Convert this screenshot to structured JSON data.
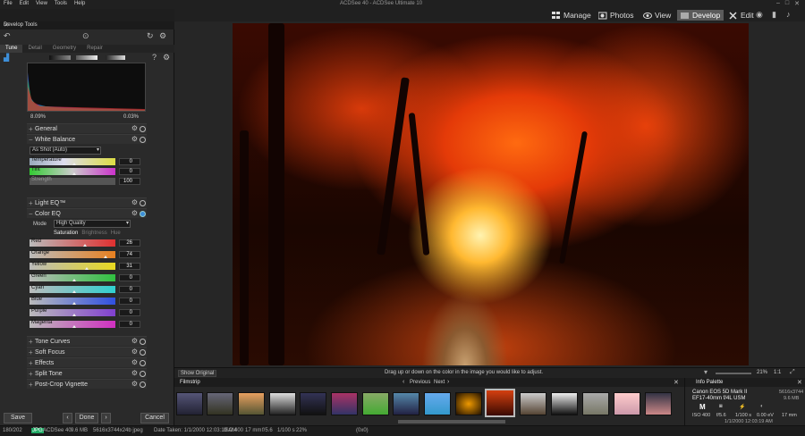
{
  "menu": [
    "File",
    "Edit",
    "View",
    "Tools",
    "Help"
  ],
  "app_title": "ACDSee 40 - ACDSee Ultimate 10",
  "modes": [
    {
      "label": "Manage",
      "icon": "grid-icon"
    },
    {
      "label": "Photos",
      "icon": "photos-icon"
    },
    {
      "label": "View",
      "icon": "eye-icon"
    },
    {
      "label": "Develop",
      "icon": "develop-icon"
    },
    {
      "label": "Edit",
      "icon": "edit-icon"
    }
  ],
  "develop_tools": {
    "title": "Develop Tools",
    "tabs": [
      "Tune",
      "Detail",
      "Geometry",
      "Repair"
    ],
    "histogram": {
      "left_pct": "8.09%",
      "right_pct": "0.03%"
    },
    "sections": {
      "general": "General",
      "white_balance": "White Balance",
      "light_eq": "Light EQ™",
      "color_eq": "Color EQ",
      "tone_curves": "Tone Curves",
      "soft_focus": "Soft Focus",
      "effects": "Effects",
      "split_tone": "Split Tone",
      "post_crop_vignette": "Post-Crop Vignette"
    },
    "wb_preset": "As Shot (Auto)",
    "wb_sliders": [
      {
        "label": "Temperature",
        "value": "0"
      },
      {
        "label": "Tint",
        "value": "0"
      },
      {
        "label": "Strength",
        "value": "100"
      }
    ],
    "color_eq_mode_label": "Mode",
    "color_eq_mode": "High Quality",
    "color_eq_subtabs": [
      "Saturation",
      "Brightness",
      "Hue"
    ],
    "color_eq_sliders": [
      {
        "label": "Red",
        "value": "26"
      },
      {
        "label": "Orange",
        "value": "74"
      },
      {
        "label": "Yellow",
        "value": "31"
      },
      {
        "label": "Green",
        "value": "0"
      },
      {
        "label": "Cyan",
        "value": "0"
      },
      {
        "label": "Blue",
        "value": "0"
      },
      {
        "label": "Purple",
        "value": "0"
      },
      {
        "label": "Magenta",
        "value": "0"
      }
    ],
    "buttons": {
      "save": "Save",
      "done": "Done",
      "cancel": "Cancel"
    }
  },
  "image_status": {
    "show_original": "Show Original",
    "hint": "Drag up or down on the color in the image you would like to adjust.",
    "zoom": "21%",
    "ratio": "1:1"
  },
  "filmstrip": {
    "title": "Filmstrip",
    "previous": "Previous",
    "next": "Next"
  },
  "info_palette": {
    "title": "Info Palette",
    "camera": "Canon EOS 5D Mark II",
    "lens": "EF17-40mm f/4L USM",
    "dimensions": "5616x3744",
    "filesize": "9.6 MB",
    "mode": "M",
    "iso": "ISO 400",
    "aperture": "f/5.6",
    "shutter": "1/100 s",
    "ev": "0.00 eV",
    "focal": "17 mm",
    "date": "1/1/2000 12:03:19 AM"
  },
  "status_bar": {
    "count": "180/202",
    "format": "JPG",
    "name": "ACDSee 40",
    "size": "9.6 MB",
    "dims": "5616x3744x24b jpeg",
    "date_taken": "Date Taken: 1/1/2000 12:03:19 AM",
    "iso": "ISO 400",
    "focal": "17 mm",
    "aperture": "f/5.6",
    "shutter": "1/100 s",
    "zoom": "22%",
    "coords": "(0x0)"
  }
}
